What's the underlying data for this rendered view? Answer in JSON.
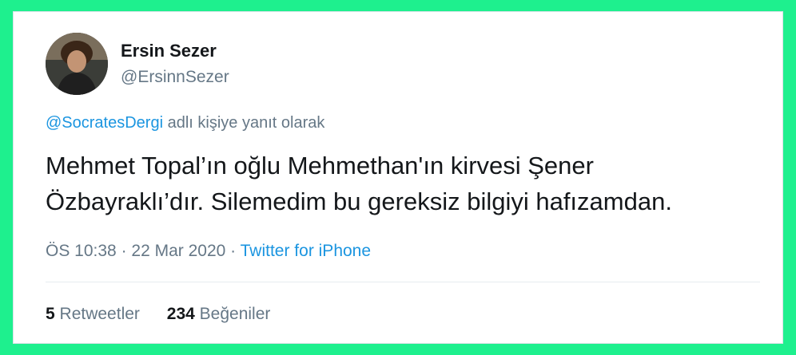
{
  "tweet": {
    "author_name": "Ersin Sezer",
    "author_handle": "@ErsinnSezer",
    "reply_mention": "@SocratesDergi",
    "reply_suffix": " adlı kişiye yanıt olarak",
    "text_line1": "Mehmet Topal’ın oğlu Mehmethan'ın kirvesi Şener",
    "text_line2": "Özbayraklı’dır. Silemedim bu gereksiz bilgiyi hafızamdan.",
    "time": "ÖS 10:38",
    "separator1": " · ",
    "date": "22 Mar 2020",
    "separator2": " · ",
    "source": "Twitter for iPhone"
  },
  "stats": {
    "retweets_count": "5",
    "retweets_label": "Retweetler",
    "likes_count": "234",
    "likes_label": "Beğeniler"
  },
  "colors": {
    "background": "#1ef08e",
    "link": "#1b95e0",
    "secondary_text": "#657786",
    "primary_text": "#14171a"
  },
  "icons": {
    "avatar": "profile-photo"
  }
}
